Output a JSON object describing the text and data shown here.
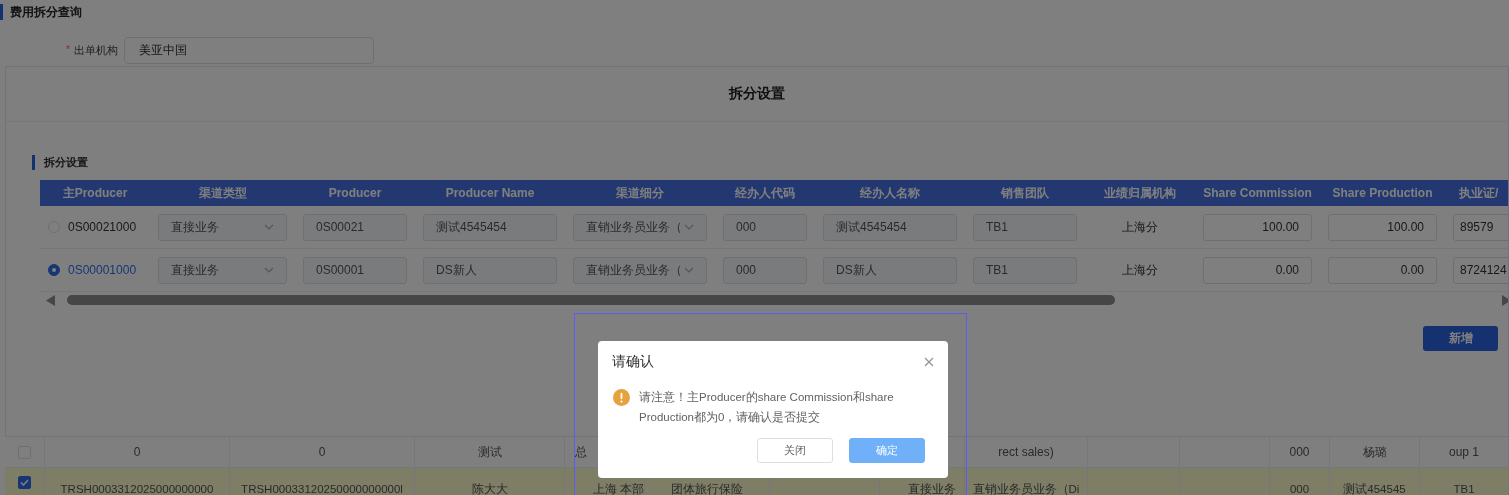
{
  "page": {
    "title": "费用拆分查询",
    "field": {
      "required_mark": "*",
      "label": "出单机构",
      "value": "美亚中国"
    }
  },
  "split_dialog": {
    "title": "拆分设置",
    "section_title": "拆分设置",
    "columns": [
      "主Producer",
      "渠道类型",
      "Producer",
      "Producer Name",
      "渠道细分",
      "经办人代码",
      "经办人名称",
      "销售团队",
      "业绩归属机构",
      "Share Commission",
      "Share Production",
      "执业证/"
    ],
    "rows": [
      {
        "selected": false,
        "code": "0S00021000",
        "channel_type": "直接业务",
        "producer": "0S00021",
        "producer_name": "测试4545454",
        "channel_detail": "直销业务员业务（",
        "agent_code": "000",
        "agent_name": "测试4545454",
        "sales_team": "TB1",
        "org": "上海分",
        "share_commission": "100.00",
        "share_production": "100.00",
        "license": "89579"
      },
      {
        "selected": true,
        "code": "0S00001000",
        "channel_type": "直接业务",
        "producer": "0S00001",
        "producer_name": "DS新人",
        "channel_detail": "直销业务员业务（",
        "agent_code": "000",
        "agent_name": "DS新人",
        "sales_team": "TB1",
        "org": "上海分",
        "share_commission": "0.00",
        "share_production": "0.00",
        "license": "8724124"
      }
    ],
    "add_button": "新增"
  },
  "background_table": {
    "rows": [
      {
        "checked": false,
        "column_1": "0",
        "column_2": "0",
        "column_3": "测试",
        "column_4": "总",
        "column_8": "rect sales)",
        "column_11": "000",
        "column_12": "杨璐",
        "column_13": "oup 1"
      },
      {
        "checked": true,
        "column_1": "TRSH0003312025000000000",
        "column_2": "TRSH00033120250000000000l",
        "column_3": "陈大大",
        "column_4": "上海 本部",
        "column_5": "团体旅行保险",
        "column_7": "直接业务",
        "column_8": "直销业务员业务（Di",
        "column_11": "000",
        "column_12": "测试454545",
        "column_13": "TB1"
      }
    ]
  },
  "confirm_dialog": {
    "title": "请确认",
    "message": "请注意！主Producer的share Commission和share Production都为0，请确认是否提交",
    "buttons": [
      {
        "label": "关闭",
        "kind": "default"
      },
      {
        "label": "确定",
        "kind": "primary"
      }
    ]
  }
}
